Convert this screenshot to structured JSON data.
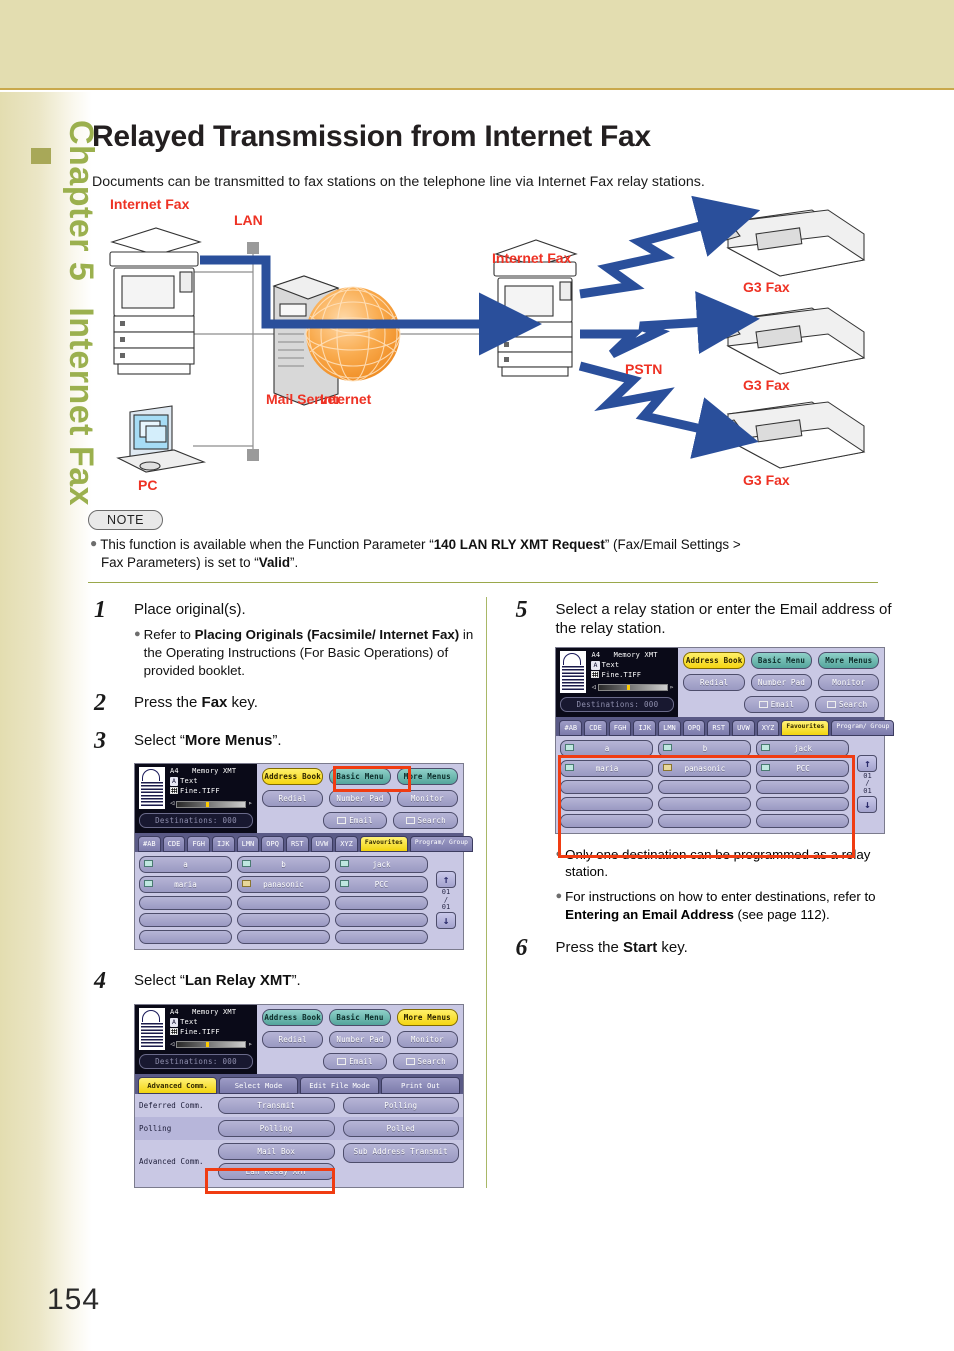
{
  "sidebar": {
    "chapter": "Chapter 5",
    "section": "Internet Fax"
  },
  "page_number": "154",
  "header": {
    "title": "Relayed Transmission from Internet Fax",
    "intro": "Documents can be transmitted to fax stations on the telephone line via Internet Fax relay stations."
  },
  "diagram": {
    "labels": {
      "internet_fax_left": "Internet Fax",
      "lan": "LAN",
      "mail_server": "Mail Server",
      "internet": "Internet",
      "pc": "PC",
      "internet_fax_right": "Internet Fax",
      "pstn": "PSTN",
      "g3_fax_1": "G3 Fax",
      "g3_fax_2": "G3 Fax",
      "g3_fax_3": "G3 Fax"
    },
    "colors": {
      "label": "#ee3224",
      "arrow": "#2a4f9b",
      "globe": "#f59b38"
    }
  },
  "note": {
    "badge": "NOTE",
    "line1_a": "This function is available when the Function Parameter “",
    "line1_b": "140 LAN RLY XMT Request",
    "line1_c": "” (Fax/Email Settings >",
    "line2_a": "Fax Parameters) is set to “",
    "line2_b": "Valid",
    "line2_c": "”."
  },
  "steps": {
    "s1": {
      "num": "1",
      "text": "Place original(s).",
      "bullet_a": "Refer to ",
      "bullet_b": "Placing Originals (Facsimile/ Internet Fax)",
      "bullet_c": " in the Operating Instructions (For Basic Operations) of provided booklet."
    },
    "s2": {
      "num": "2",
      "pre": "Press the ",
      "bold": "Fax",
      "post": " key."
    },
    "s3": {
      "num": "3",
      "pre": "Select “",
      "bold": "More Menus",
      "post": "”."
    },
    "s4": {
      "num": "4",
      "pre": "Select “",
      "bold": "Lan Relay XMT",
      "post": "”."
    },
    "s5": {
      "num": "5",
      "text": "Select a relay station or enter the Email address of the relay station.",
      "bullet1": "Only one destination can be programmed as a relay station.",
      "bullet2_a": "For instructions on how to enter destinations, refer to ",
      "bullet2_b": "Entering an Email Address",
      "bullet2_c": " (see page 112)."
    },
    "s6": {
      "num": "6",
      "pre": "Press the ",
      "bold": "Start",
      "post": " key."
    }
  },
  "lcd": {
    "info": {
      "paper": "A4",
      "mode": "Memory XMT",
      "text_badge": "A",
      "text_label": "Text",
      "resolution": "Fine.TIFF",
      "destinations": "Destinations: 000"
    },
    "top_keys": {
      "address_book": "Address Book",
      "basic_menu": "Basic Menu",
      "more_menus": "More Menus",
      "redial": "Redial",
      "number_pad": "Number Pad",
      "monitor": "Monitor",
      "email": "Email",
      "search": "Search"
    },
    "address_tabs": [
      "#AB",
      "CDE",
      "FGH",
      "IJK",
      "LMN",
      "OPQ",
      "RST",
      "UVW",
      "XYZ",
      "Favourites",
      "Program/ Group"
    ],
    "active_tab": "Favourites",
    "address_rows": [
      [
        {
          "label": "a",
          "type": "email"
        },
        {
          "label": "b",
          "type": "email"
        },
        {
          "label": "jack",
          "type": "email"
        }
      ],
      [
        {
          "label": "maria",
          "type": "email"
        },
        {
          "label": "panasonic",
          "type": "group"
        },
        {
          "label": "PCC",
          "type": "email"
        }
      ],
      [
        {
          "label": "",
          "type": "empty"
        },
        {
          "label": "",
          "type": "empty"
        },
        {
          "label": "",
          "type": "empty"
        }
      ],
      [
        {
          "label": "",
          "type": "empty"
        },
        {
          "label": "",
          "type": "empty"
        },
        {
          "label": "",
          "type": "empty"
        }
      ],
      [
        {
          "label": "",
          "type": "empty"
        },
        {
          "label": "",
          "type": "empty"
        },
        {
          "label": "",
          "type": "empty"
        }
      ]
    ],
    "page_current": "01",
    "page_sep": "/",
    "page_total": "01",
    "mode_tabs": [
      "Advanced Comm.",
      "Select Mode",
      "Edit File Mode",
      "Print Out"
    ],
    "mode_active_tab": "Advanced Comm.",
    "mode_rows": [
      {
        "label": "Deferred Comm.",
        "buttons": [
          "Transmit",
          "Polling"
        ]
      },
      {
        "label": "Polling",
        "buttons": [
          "Polling",
          "Polled"
        ]
      },
      {
        "label": "Advanced Comm.",
        "buttons": [
          "Mail Box",
          "Sub Address Transmit",
          "Lan Relay XMT"
        ]
      }
    ]
  },
  "colors": {
    "band": "#e3ddb0",
    "band_border": "#c9a84c",
    "side_text": "#9bb04e",
    "highlight": "#f03c12",
    "lcd_bg": "#c9c8e4",
    "lcd_info_bg": "#0a0a18"
  }
}
